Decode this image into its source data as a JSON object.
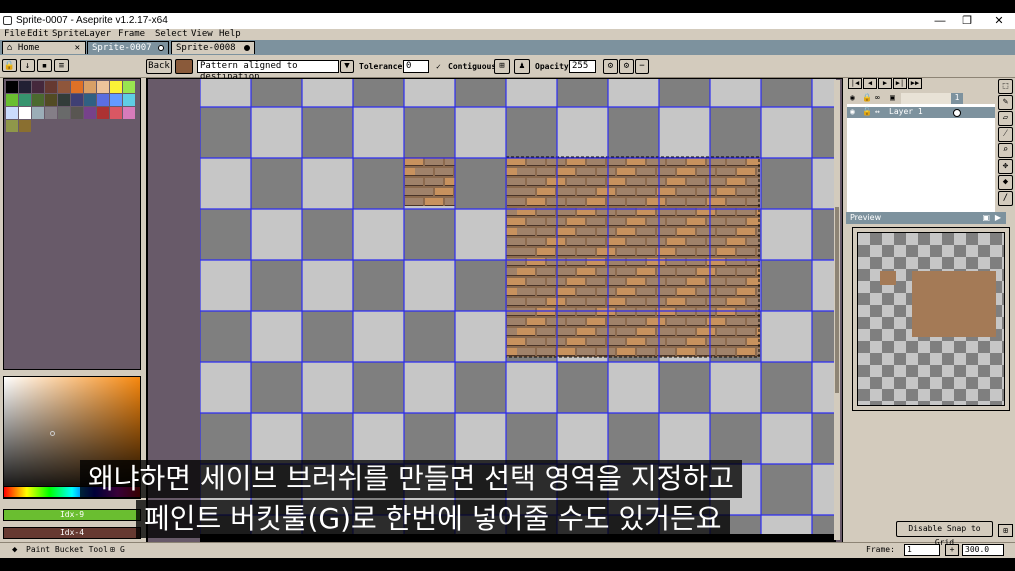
{
  "window": {
    "title": "Sprite-0007 - Aseprite v1.2.17-x64",
    "minimize": "—",
    "maximize": "❐",
    "close": "✕"
  },
  "menu": [
    "File",
    "Edit",
    "Sprite",
    "Layer",
    "Frame",
    "Select",
    "View",
    "Help"
  ],
  "tabs": [
    {
      "label": "Home",
      "icon": "home-icon",
      "close": "✕"
    },
    {
      "label": "Sprite-0007",
      "active": true
    },
    {
      "label": "Sprite-0008"
    }
  ],
  "toolbar": {
    "back_label": "Back",
    "pattern_value": "Pattern aligned to destination",
    "tolerance_label": "Tolerance:",
    "tolerance_value": "0",
    "contiguous_label": "Contiguous",
    "opacity_label": "Opacity:",
    "opacity_value": "255"
  },
  "palette": {
    "colors": [
      "#000000",
      "#222034",
      "#45283c",
      "#663931",
      "#8f563b",
      "#df7126",
      "#d9a066",
      "#eec39a",
      "#fbf236",
      "#99e550",
      "#6abe30",
      "#37946e",
      "#4b692f",
      "#524b24",
      "#323c39",
      "#3f3f74",
      "#306082",
      "#5b6ee1",
      "#639bff",
      "#5fcde4",
      "#cbdbfc",
      "#ffffff",
      "#9badb7",
      "#847e87",
      "#696a6a",
      "#595652",
      "#76428a",
      "#ac3232",
      "#d95763",
      "#d77bba",
      "#8f974a",
      "#8a6f30"
    ]
  },
  "colors": {
    "fg_index": "Idx-9",
    "bg_index": "Idx-4",
    "fg_color": "#6abe30",
    "bg_color": "#663931"
  },
  "layers": [
    {
      "name": "",
      "frame": "1"
    },
    {
      "name": "Layer 1",
      "selected": true
    }
  ],
  "preview": {
    "title": "Preview"
  },
  "status": {
    "tool": "Paint Bucket Tool",
    "shortcut": "G",
    "frame_label": "Frame:",
    "frame_value": "1",
    "zoom_value": "300.0",
    "snap_button": "Disable Snap to Grid"
  },
  "subtitles": {
    "line1": "왜냐하면 세이브 브러쉬를 만들면 선택 영역을 지정하고",
    "line2": "페인트 버킷툴(G)로 한번에 넣어줄 수도 있거든요"
  }
}
